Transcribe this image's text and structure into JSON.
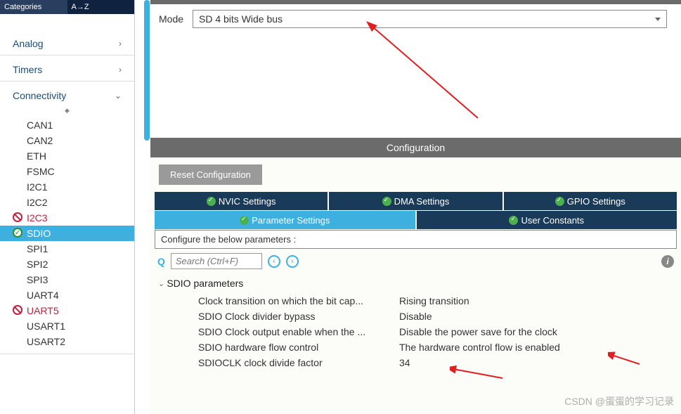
{
  "sidebar": {
    "header_tabs": [
      "Categories",
      "A→Z"
    ],
    "categories": [
      {
        "label": "Analog",
        "expanded": false
      },
      {
        "label": "Timers",
        "expanded": false
      },
      {
        "label": "Connectivity",
        "expanded": true
      }
    ],
    "connectivity_items": [
      {
        "label": "CAN1",
        "state": "normal"
      },
      {
        "label": "CAN2",
        "state": "normal"
      },
      {
        "label": "ETH",
        "state": "normal"
      },
      {
        "label": "FSMC",
        "state": "normal"
      },
      {
        "label": "I2C1",
        "state": "normal"
      },
      {
        "label": "I2C2",
        "state": "normal"
      },
      {
        "label": "I2C3",
        "state": "disabled"
      },
      {
        "label": "SDIO",
        "state": "active"
      },
      {
        "label": "SPI1",
        "state": "normal"
      },
      {
        "label": "SPI2",
        "state": "normal"
      },
      {
        "label": "SPI3",
        "state": "normal"
      },
      {
        "label": "UART4",
        "state": "normal"
      },
      {
        "label": "UART5",
        "state": "disabled"
      },
      {
        "label": "USART1",
        "state": "normal"
      },
      {
        "label": "USART2",
        "state": "normal"
      }
    ]
  },
  "mode": {
    "label": "Mode",
    "value": "SD 4 bits Wide bus"
  },
  "config": {
    "header": "Configuration",
    "reset_btn": "Reset Configuration",
    "tabs_row1": [
      "NVIC Settings",
      "DMA Settings",
      "GPIO Settings"
    ],
    "tabs_row2": [
      "Parameter Settings",
      "User Constants"
    ],
    "hint": "Configure the below parameters :",
    "search_placeholder": "Search (Ctrl+F)",
    "section_title": "SDIO parameters",
    "params": [
      {
        "name": "Clock transition on which the bit cap...",
        "value": "Rising transition"
      },
      {
        "name": "SDIO Clock divider bypass",
        "value": "Disable"
      },
      {
        "name": "SDIO Clock output enable when the ...",
        "value": "Disable the power save for the clock"
      },
      {
        "name": "SDIO hardware flow control",
        "value": "The hardware control flow is enabled"
      },
      {
        "name": "SDIOCLK clock divide factor",
        "value": "34"
      }
    ]
  },
  "watermark": "CSDN @蛋蛋的学习记录"
}
